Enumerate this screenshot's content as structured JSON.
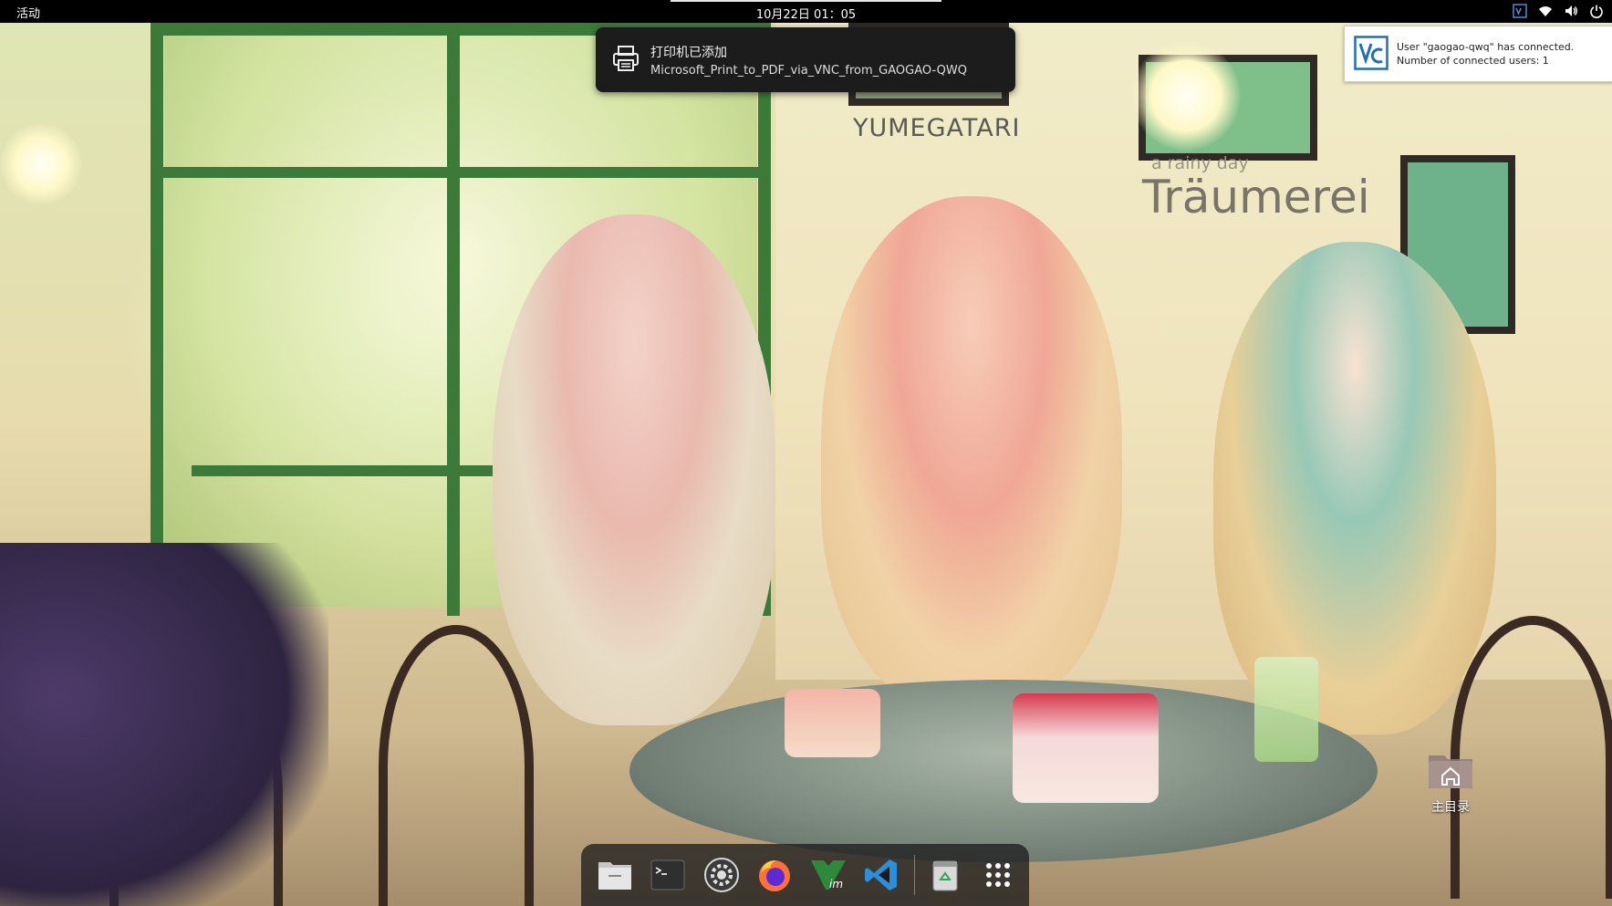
{
  "topbar": {
    "activities_label": "活动",
    "clock": "10月22日 01：05",
    "tray_icons": [
      "vnc-tray-icon",
      "wifi-icon",
      "volume-icon",
      "power-icon"
    ]
  },
  "notification": {
    "icon": "printer-icon",
    "title": "打印机已添加",
    "body": "Microsoft_Print_to_PDF_via_VNC_from_GAOGAO-QWQ"
  },
  "vnc_popup": {
    "icon": "vnc-logo-icon",
    "line1": "User \"gaogao-qwq\" has connected.",
    "line2": "Number of connected users: 1"
  },
  "wallpaper": {
    "brand": "YUMEGATARI",
    "subtitle": "a rainy day",
    "title": "Träumerei"
  },
  "desktop": {
    "icons": [
      {
        "icon": "home-folder-icon",
        "label": "主目录"
      }
    ]
  },
  "dock": {
    "items": [
      {
        "icon": "files-icon"
      },
      {
        "icon": "terminal-icon"
      },
      {
        "icon": "settings-icon"
      },
      {
        "icon": "firefox-icon"
      },
      {
        "icon": "vim-icon"
      },
      {
        "icon": "vscode-icon"
      },
      {
        "icon": "trash-icon"
      },
      {
        "icon": "show-apps-icon"
      }
    ]
  },
  "colors": {
    "topbar_bg": "#000000",
    "notification_bg": "#1c1c1c",
    "vscode_blue": "#2b8fd9",
    "vnc_blue": "#1f6fb5"
  }
}
